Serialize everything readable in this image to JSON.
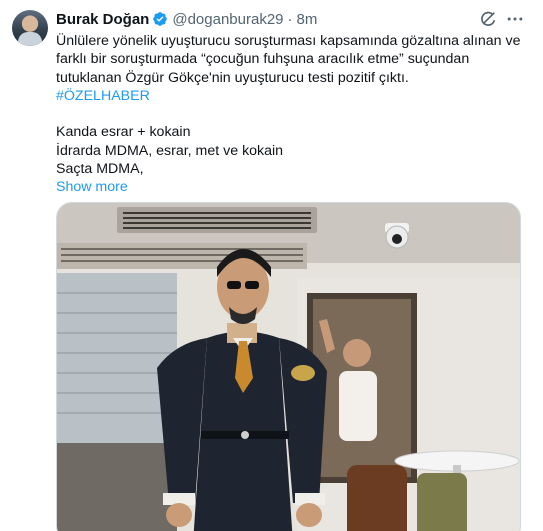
{
  "tweet": {
    "author": {
      "display_name": "Burak Doğan",
      "handle": "@doganburak29",
      "time": "8m",
      "verified": true
    },
    "text": {
      "line1": "Ünlülere yönelik uyuşturucu soruşturması kapsamında gözaltına alınan ve",
      "line2": "farklı bir soruşturmada “çocuğun fuhşuna aracılık etme” suçundan",
      "line3": "tutuklanan Özgür Gökçe'nin uyuşturucu testi pozitif çıktı.",
      "line4": "Kanda esrar + kokain",
      "line5": "İdrarda MDMA, esrar, met ve kokain",
      "line6": "Saçta MDMA,"
    },
    "hashtag": "#ÖZELHABER",
    "show_more": "Show more",
    "icons": {
      "verified": "verified-badge-icon",
      "grok": "grok-icon",
      "more": "more-horizontal-icon"
    },
    "colors": {
      "link": "#1d9bf0",
      "secondary_text": "#536471",
      "primary_text": "#0f1419"
    }
  }
}
